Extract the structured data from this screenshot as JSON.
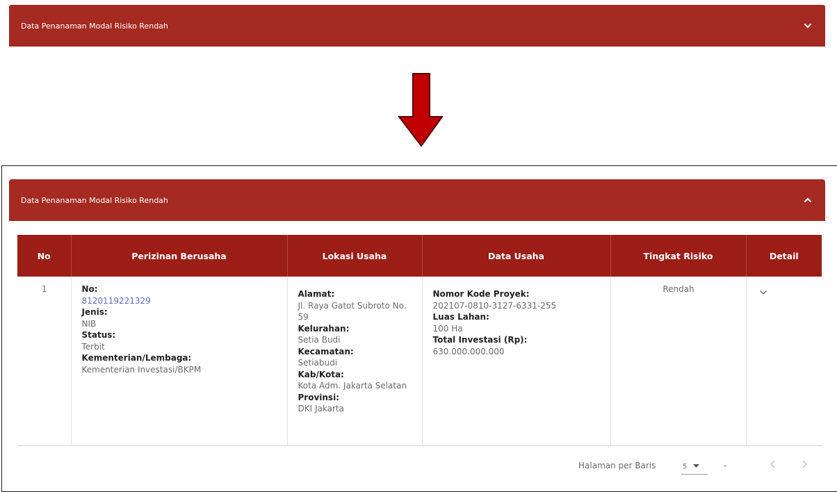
{
  "top_panel": {
    "title": "Data Penanaman Modal Risiko Rendah",
    "toggle_icon": "chevron-down-icon"
  },
  "arrow_icon": "arrow-down-icon",
  "arrow_color": "#c00000",
  "bottom_panel": {
    "title": "Data Penanaman Modal Risiko Rendah",
    "toggle_icon": "chevron-up-icon"
  },
  "table": {
    "headers": [
      "No",
      "Perizinan Berusaha",
      "Lokasi Usaha",
      "Data Usaha",
      "Tingkat Risiko",
      "Detail"
    ],
    "rows": [
      {
        "no": "1",
        "perizinan": {
          "no_label": "No:",
          "no_value": "8120119221329",
          "jenis_label": "Jenis:",
          "jenis_value": "NIB",
          "status_label": "Status:",
          "status_value": "Terbit",
          "kementerian_label": "Kementerian/Lembaga:",
          "kementerian_value": "Kementerian Investasi/BKPM"
        },
        "lokasi": {
          "alamat_label": "Alamat:",
          "alamat_value": "Jl. Raya Gatot Subroto No. 59",
          "kelurahan_label": "Kelurahan:",
          "kelurahan_value": "Setia Budi",
          "kecamatan_label": "Kecamatan:",
          "kecamatan_value": "Setiabudi",
          "kabkota_label": "Kab/Kota:",
          "kabkota_value": "Kota Adm. Jakarta Selatan",
          "provinsi_label": "Provinsi:",
          "provinsi_value": "DKI Jakarta"
        },
        "data_usaha": {
          "kode_label": "Nomor Kode Proyek:",
          "kode_value": "202107-0810-3127-6331-255",
          "luas_label": "Luas Lahan:",
          "luas_value": "100 Ha",
          "investasi_label": "Total Investasi (Rp):",
          "investasi_value": "630.000.000.000"
        },
        "tingkat_risiko": "Rendah",
        "detail_icon": "chevron-down-icon"
      }
    ]
  },
  "pagination": {
    "rows_label": "Halaman per Baris",
    "rows_value": "5",
    "range_text": "-"
  },
  "colors": {
    "header_red": "#a52a22",
    "table_header_red": "#9c1e17",
    "link_blue": "#5c6bc0"
  }
}
